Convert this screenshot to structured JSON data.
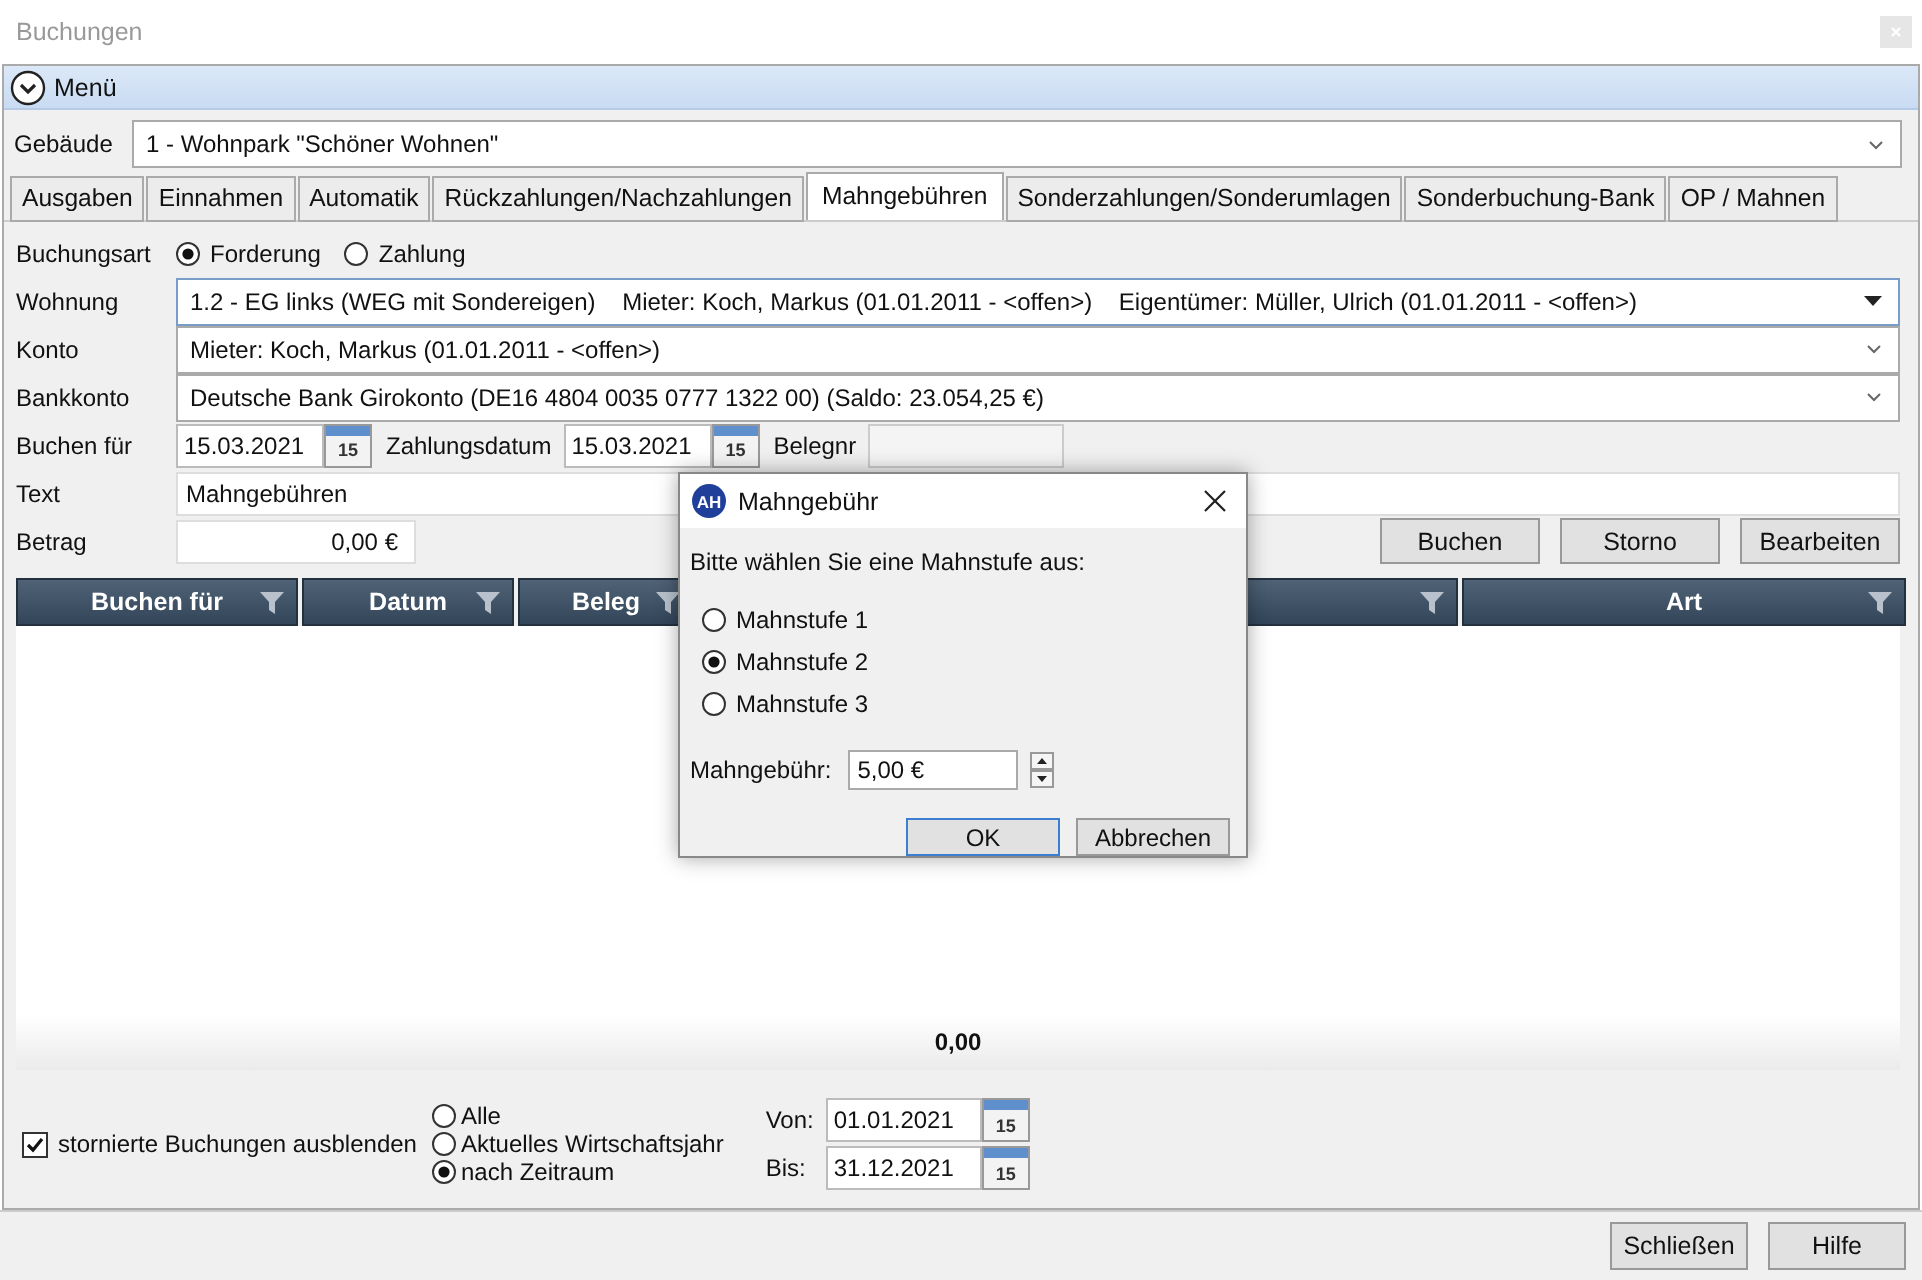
{
  "window": {
    "title": "Buchungen"
  },
  "menu": {
    "label": "Menü"
  },
  "building": {
    "label": "Gebäude",
    "value": "1 - Wohnpark \"Schöner Wohnen\""
  },
  "tabs": [
    {
      "label": "Ausgaben",
      "selected": false
    },
    {
      "label": "Einnahmen",
      "selected": false
    },
    {
      "label": "Automatik",
      "selected": false
    },
    {
      "label": "Rückzahlungen/Nachzahlungen",
      "selected": false
    },
    {
      "label": "Mahngebühren",
      "selected": true
    },
    {
      "label": "Sonderzahlungen/Sonderumlagen",
      "selected": false
    },
    {
      "label": "Sonderbuchung-Bank",
      "selected": false
    },
    {
      "label": "OP / Mahnen",
      "selected": false
    }
  ],
  "booking_type": {
    "label": "Buchungsart",
    "options": [
      {
        "label": "Forderung",
        "selected": true
      },
      {
        "label": "Zahlung",
        "selected": false
      }
    ]
  },
  "selects": [
    {
      "label": "Wohnung",
      "value": "1.2 - EG links (WEG mit Sondereigen)    Mieter: Koch, Markus (01.01.2011 - <offen>)    Eigentümer: Müller, Ulrich (01.01.2011 - <offen>)",
      "kind": "triangle"
    },
    {
      "label": "Konto",
      "value": "Mieter: Koch, Markus (01.01.2011 - <offen>)",
      "kind": "chevron"
    },
    {
      "label": "Bankkonto",
      "value": "Deutsche Bank Girokonto (DE16 4804 0035 0777 1322 00) (Saldo: 23.054,25 €)",
      "kind": "chevron"
    }
  ],
  "book_for": {
    "label": "Buchen für",
    "value": "15.03.2021",
    "calendar_day": "15"
  },
  "payment_date": {
    "label": "Zahlungsdatum",
    "value": "15.03.2021",
    "calendar_day": "15"
  },
  "receipt": {
    "label": "Belegnr"
  },
  "text": {
    "label": "Text",
    "value": "Mahngebühren"
  },
  "amount": {
    "label": "Betrag",
    "value": "0,00 €"
  },
  "actions": [
    "Buchen",
    "Storno",
    "Bearbeiten"
  ],
  "table": {
    "columns": [
      {
        "label": "Buchen für"
      },
      {
        "label": "Datum"
      },
      {
        "label": "Beleg"
      },
      {},
      {
        "label": "Art"
      }
    ],
    "total": "0,00"
  },
  "hide_cancelled": {
    "label": "stornierte Buchungen ausblenden",
    "checked": true
  },
  "period": [
    {
      "label": "Alle",
      "selected": false
    },
    {
      "label": "Aktuelles Wirtschaftsjahr",
      "selected": false
    },
    {
      "label": "nach Zeitraum",
      "selected": true
    }
  ],
  "from": {
    "label": "Von:",
    "value": "01.01.2021",
    "calendar_day": "15"
  },
  "to": {
    "label": "Bis:",
    "value": "31.12.2021",
    "calendar_day": "15"
  },
  "footer_buttons": [
    "Schließen",
    "Hilfe"
  ],
  "dialog": {
    "logo": "AH",
    "title": "Mahngebühr",
    "prompt": "Bitte wählen Sie eine Mahnstufe aus:",
    "levels": [
      {
        "label": "Mahnstufe 1",
        "selected": false
      },
      {
        "label": "Mahnstufe 2",
        "selected": true
      },
      {
        "label": "Mahnstufe 3",
        "selected": false
      }
    ],
    "fee_label": "Mahngebühr:",
    "fee_value": "5,00 €",
    "buttons": [
      "OK",
      "Abbrechen"
    ]
  }
}
